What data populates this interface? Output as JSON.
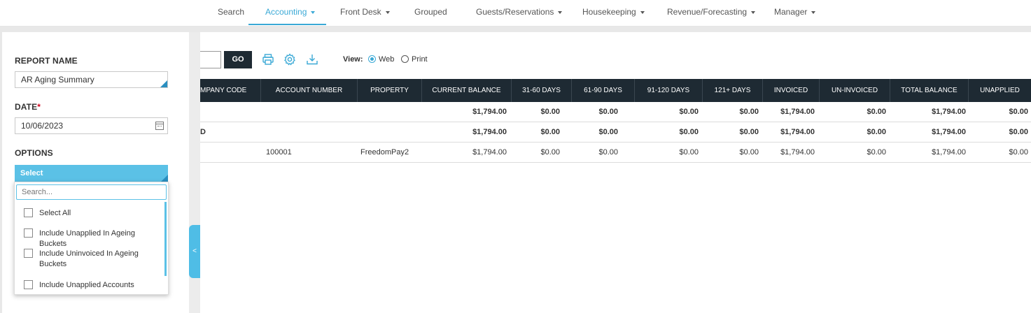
{
  "nav": {
    "items": [
      {
        "label": "Search",
        "dropdown": false
      },
      {
        "label": "Accounting",
        "dropdown": true,
        "active": true
      },
      {
        "label": "Front Desk",
        "dropdown": true
      },
      {
        "label": "Grouped",
        "dropdown": false
      },
      {
        "label": "Guests/Reservations",
        "dropdown": true
      },
      {
        "label": "Housekeeping",
        "dropdown": true
      },
      {
        "label": "Revenue/Forecasting",
        "dropdown": true
      },
      {
        "label": "Manager",
        "dropdown": true
      }
    ]
  },
  "sidebar": {
    "report_name_label": "REPORT NAME",
    "report_name_value": "AR Aging Summary",
    "date_label": "DATE",
    "date_required": "*",
    "date_value": "10/06/2023",
    "options_label": "OPTIONS",
    "select_label": "Select",
    "search_placeholder": "Search...",
    "options": [
      {
        "label": "Select All",
        "checked": false
      },
      {
        "label": "Include Unapplied In Ageing Buckets",
        "checked": false
      },
      {
        "label": "Include Uninvoiced In Ageing Buckets",
        "checked": false
      },
      {
        "label": "Include Unapplied Accounts",
        "checked": false
      }
    ],
    "collapse_glyph": "<"
  },
  "toolbar": {
    "go_label": "GO",
    "view_label": "View:",
    "view_options": [
      "Web",
      "Print"
    ],
    "view_selected": "Web",
    "icons": [
      "print-icon",
      "settings-icon",
      "download-icon"
    ]
  },
  "table": {
    "headers": [
      "MPANY CODE",
      "ACCOUNT NUMBER",
      "PROPERTY",
      "CURRENT BALANCE",
      "31-60 DAYS",
      "61-90 DAYS",
      "91-120 DAYS",
      "121+ DAYS",
      "INVOICED",
      "UN-INVOICED",
      "TOTAL BALANCE",
      "UNAPPLIED"
    ],
    "rows": [
      {
        "bold": true,
        "cells": [
          "",
          "",
          "",
          "$1,794.00",
          "$0.00",
          "$0.00",
          "$0.00",
          "$0.00",
          "$1,794.00",
          "$0.00",
          "$1,794.00",
          "$0.00"
        ]
      },
      {
        "bold": true,
        "cells": [
          "D",
          "",
          "",
          "$1,794.00",
          "$0.00",
          "$0.00",
          "$0.00",
          "$0.00",
          "$1,794.00",
          "$0.00",
          "$1,794.00",
          "$0.00"
        ]
      },
      {
        "bold": false,
        "cells": [
          "",
          "100001",
          "FreedomPay2",
          "$1,794.00",
          "$0.00",
          "$0.00",
          "$0.00",
          "$0.00",
          "$1,794.00",
          "$0.00",
          "$1,794.00",
          "$0.00"
        ]
      }
    ]
  },
  "colors": {
    "accent": "#3aa9d6",
    "header_bg": "#1e2a33",
    "select_bg": "#5bc1e6"
  }
}
